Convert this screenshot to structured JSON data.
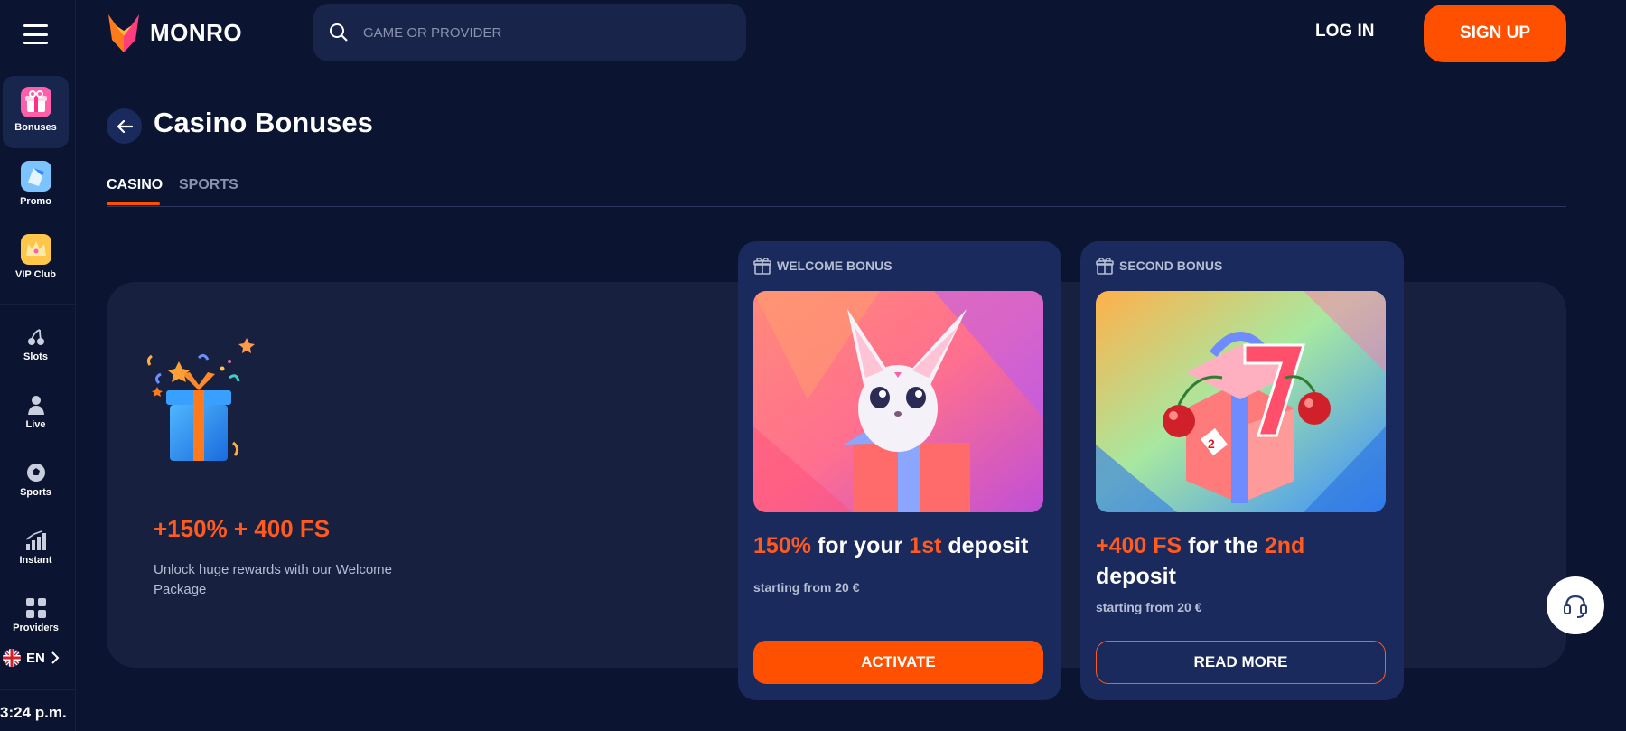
{
  "brand": {
    "name": "MONRO",
    "accent": "#ff5000",
    "background": "#0b1430"
  },
  "header": {
    "search_placeholder": "GAME OR PROVIDER",
    "login_label": "LOG IN",
    "signup_label": "SIGN UP"
  },
  "sidebar": {
    "items": [
      {
        "label": "Bonuses",
        "icon": "gift-icon",
        "active": true
      },
      {
        "label": "Promo",
        "icon": "promo-icon"
      },
      {
        "label": "VIP Club",
        "icon": "crown-icon"
      },
      {
        "label": "Slots",
        "icon": "cherry-icon"
      },
      {
        "label": "Live",
        "icon": "dealer-icon"
      },
      {
        "label": "Sports",
        "icon": "ball-icon"
      },
      {
        "label": "Instant",
        "icon": "chart-icon"
      },
      {
        "label": "Providers",
        "icon": "grid-icon"
      }
    ],
    "language": "EN",
    "time": "3:24 p.m."
  },
  "page": {
    "title": "Casino Bonuses",
    "tabs": [
      {
        "label": "CASINO",
        "active": true
      },
      {
        "label": "SPORTS",
        "active": false
      }
    ]
  },
  "hero": {
    "title": "+150% + 400 FS",
    "description": "Unlock huge rewards with our Welcome Package"
  },
  "cards": [
    {
      "label": "WELCOME BONUS",
      "title_parts": [
        "150%",
        " for your ",
        "1st",
        " deposit"
      ],
      "subtitle": "starting from 20 €",
      "button": "ACTIVATE"
    },
    {
      "label": "SECOND BONUS",
      "title_parts": [
        "+400 FS",
        " for the ",
        "2nd",
        " deposit"
      ],
      "subtitle": "starting from 20 €",
      "button": "READ MORE"
    }
  ]
}
